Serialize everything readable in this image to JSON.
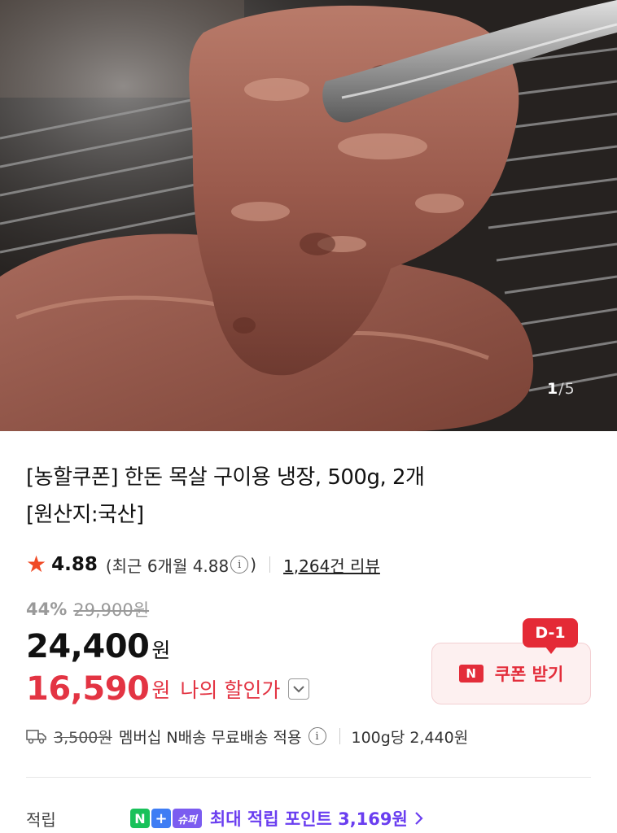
{
  "gallery": {
    "current": "1",
    "separator": "/",
    "total": "5",
    "image_icon": "grilled-pork-photo"
  },
  "product": {
    "title_line1": "[농할쿠폰] 한돈 목살 구이용 냉장, 500g, 2개",
    "title_line2": "[원산지:국산]"
  },
  "rating": {
    "star": "★",
    "score": "4.88",
    "recent_prefix": "(최근 6개월 4.88",
    "info": "i",
    "recent_suffix": ")",
    "reviews": "1,264건 리뷰"
  },
  "pricing": {
    "discount_rate": "44%",
    "original_price": "29,900원",
    "sale_price": "24,400",
    "sale_unit": "원",
    "my_price": "16,590",
    "my_unit": "원",
    "my_label": "나의 할인가"
  },
  "coupon": {
    "dday": "D-1",
    "badge": "N",
    "label": "쿠폰 받기"
  },
  "shipping": {
    "fee": "3,500원",
    "text": "멤버십 N배송 무료배송 적용",
    "info": "i",
    "unit_price": "100g당 2,440원"
  },
  "points": {
    "label": "적립",
    "badge_n": "N",
    "badge_plus": "+",
    "badge_super": "슈퍼",
    "text": "최대 적립 포인트 3,169원"
  },
  "colors": {
    "accent_red": "#e33443",
    "star": "#f04a25",
    "points_purple": "#6a3ef0",
    "naver_green": "#19c15a"
  }
}
